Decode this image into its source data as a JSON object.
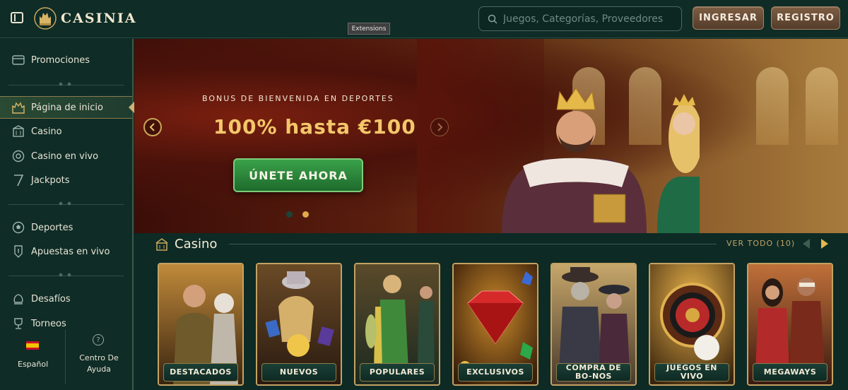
{
  "header": {
    "brand": "CASINIA",
    "search_placeholder": "Juegos, Categorías, Proveedores",
    "login_label": "INGRESAR",
    "register_label": "REGISTRO",
    "tooltip": "Extensions"
  },
  "sidebar": {
    "promotions": "Promociones",
    "items": [
      {
        "label": "Página de inicio",
        "icon": "home-castle-icon"
      },
      {
        "label": "Casino",
        "icon": "casino-icon"
      },
      {
        "label": "Casino en vivo",
        "icon": "live-casino-icon"
      },
      {
        "label": "Jackpots",
        "icon": "jackpot-seven-icon"
      }
    ],
    "sports": [
      {
        "label": "Deportes",
        "icon": "soccer-ball-icon"
      },
      {
        "label": "Apuestas en vivo",
        "icon": "live-bets-icon"
      }
    ],
    "extra": [
      {
        "label": "Desafíos",
        "icon": "challenges-icon"
      },
      {
        "label": "Torneos",
        "icon": "trophy-icon"
      }
    ],
    "language": "Español",
    "help": "Centro De Ayuda"
  },
  "hero": {
    "eyebrow": "BONUS DE BIENVENIDA EN DEPORTES",
    "title": "100% hasta €100",
    "cta": "ÚNETE AHORA",
    "active_slide": 2,
    "total_slides": 2
  },
  "casino": {
    "title": "Casino",
    "view_all": "VER TODO (10)",
    "cards": [
      {
        "label": "DESTACADOS"
      },
      {
        "label": "NUEVOS"
      },
      {
        "label": "POPULARES"
      },
      {
        "label": "EXCLUSIVOS"
      },
      {
        "label": "COMPRA DE BO-NOS"
      },
      {
        "label": "JUEGOS EN VIVO"
      },
      {
        "label": "MEGAWAYS"
      }
    ]
  },
  "colors": {
    "background": "#0e2a24",
    "gold": "#c4a264",
    "cta_green": "#2f8a3c",
    "brown_button": "#6a4d36"
  }
}
